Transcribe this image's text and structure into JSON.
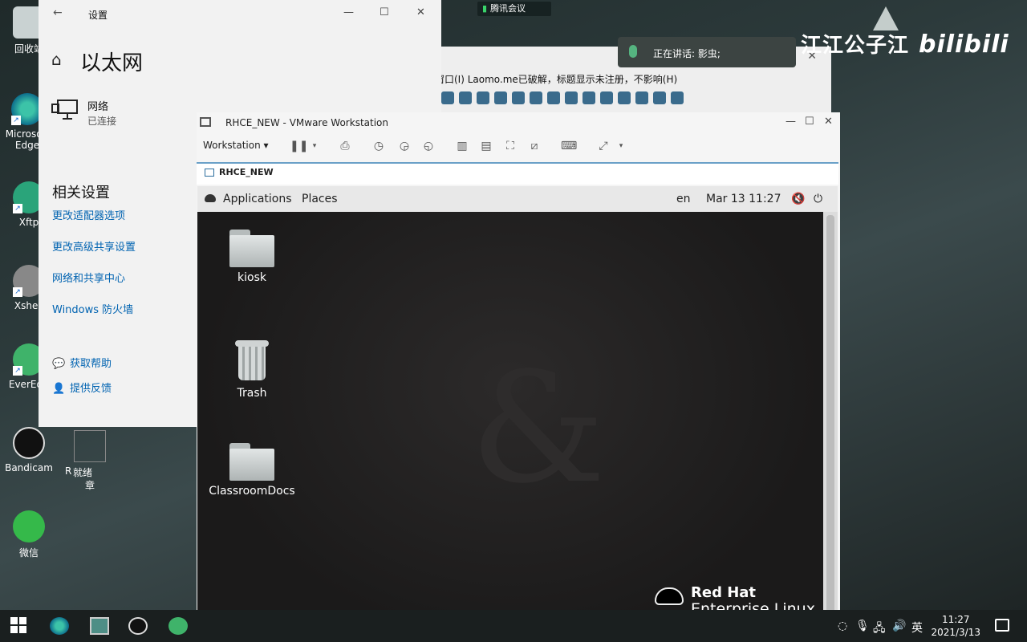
{
  "desktop": {
    "icons": [
      {
        "label": "回收站"
      },
      {
        "label": "Microsoft Edge"
      },
      {
        "label": "Xftp"
      },
      {
        "label": "Xshell"
      },
      {
        "label": "EverEdit"
      },
      {
        "label": "Bandicam"
      },
      {
        "label": "微信"
      }
    ],
    "partial_label_1": "R",
    "partial_label_2": "就绪",
    "partial_label_3": "章"
  },
  "settings": {
    "window_title": "设置",
    "page_title": "以太网",
    "network_name": "网络",
    "network_status": "已连接",
    "related_heading": "相关设置",
    "links": [
      "更改适配器选项",
      "更改高级共享设置",
      "网络和共享中心",
      "Windows 防火墙"
    ],
    "help": "获取帮助",
    "feedback": "提供反馈"
  },
  "bg_window": {
    "menu_text": "窗口(I)    Laomo.me已破解，标题显示未注册，不影响(H)"
  },
  "vmware": {
    "window_title": "RHCE_NEW - VMware Workstation",
    "workstation_menu": "Workstation",
    "tab_label": "RHCE_NEW",
    "guest": {
      "menu_applications": "Applications",
      "menu_places": "Places",
      "lang": "en",
      "datetime": "Mar 13  11:27",
      "icons": [
        {
          "label": "kiosk"
        },
        {
          "label": "Trash"
        },
        {
          "label": "ClassroomDocs"
        }
      ],
      "brand_line1": "Red Hat",
      "brand_line2": "Enterprise Linux"
    }
  },
  "overlay": {
    "meeting_app": "腾讯会议",
    "speaking_text": "正在讲话: 影虫;",
    "watermark_text": "江江公子江",
    "watermark_brand": "bilibili"
  },
  "taskbar": {
    "ime": "英",
    "time": "11:27",
    "date": "2021/3/13"
  }
}
